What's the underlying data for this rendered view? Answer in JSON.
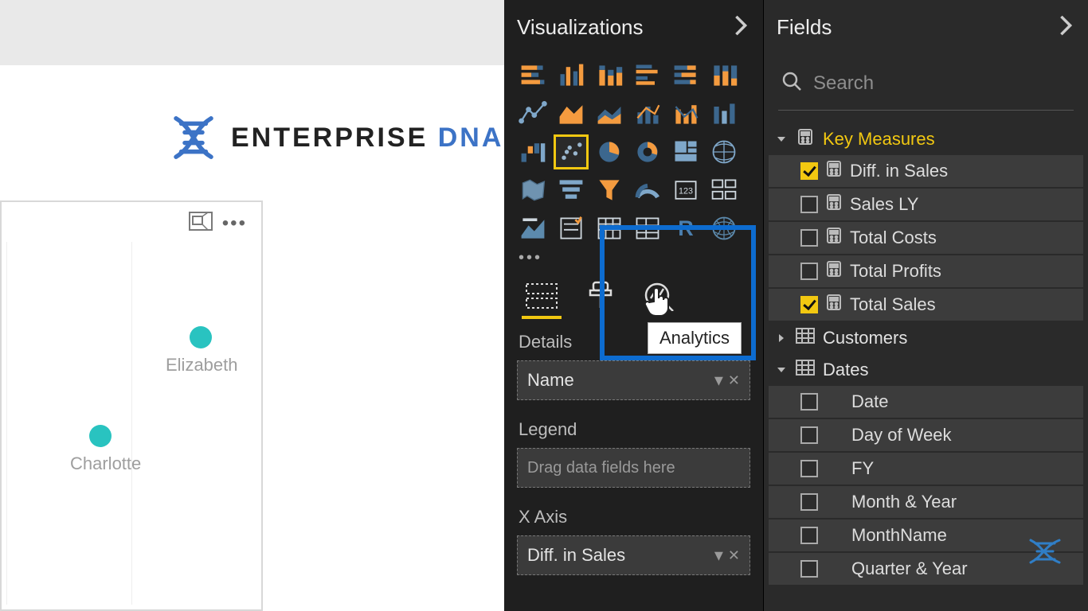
{
  "branding": {
    "name_a": "ENTERPRISE",
    "name_b": "DNA"
  },
  "canvas": {
    "scatter": {
      "points": [
        {
          "label": "Elizabeth"
        },
        {
          "label": "Charlotte"
        }
      ]
    }
  },
  "viz_pane": {
    "title": "Visualizations",
    "tooltip": "Analytics",
    "tabs": {
      "fields": "fields-tab",
      "format": "format-tab",
      "analytics": "analytics-tab"
    },
    "wells": {
      "details": {
        "label": "Details",
        "field": "Name"
      },
      "legend": {
        "label": "Legend",
        "placeholder": "Drag data fields here"
      },
      "xaxis": {
        "label": "X Axis",
        "field": "Diff. in Sales"
      }
    },
    "gallery": {
      "selected_index": 13,
      "icons": [
        "stacked-bar",
        "clustered-column",
        "stacked-column",
        "clustered-bar",
        "100-stacked-bar",
        "100-stacked-column",
        "line",
        "area",
        "stacked-area",
        "line-column",
        "line-column2",
        "ribbon",
        "waterfall",
        "scatter",
        "pie",
        "donut",
        "treemap",
        "map",
        "filled-map",
        "funnel-alt",
        "funnel",
        "gauge",
        "card",
        "multi-card",
        "kpi",
        "slicer",
        "table",
        "matrix",
        "r-visual",
        "arc-gis"
      ]
    }
  },
  "fields_pane": {
    "title": "Fields",
    "search_placeholder": "Search",
    "tables": [
      {
        "name": "Key Measures",
        "expanded": true,
        "highlighted": true,
        "icon": "measure-table",
        "fields": [
          {
            "name": "Diff. in Sales",
            "checked": true,
            "icon": "calc"
          },
          {
            "name": "Sales LY",
            "checked": false,
            "icon": "calc"
          },
          {
            "name": "Total Costs",
            "checked": false,
            "icon": "calc"
          },
          {
            "name": "Total Profits",
            "checked": false,
            "icon": "calc"
          },
          {
            "name": "Total Sales",
            "checked": true,
            "icon": "calc"
          }
        ]
      },
      {
        "name": "Customers",
        "expanded": false,
        "icon": "table",
        "fields": []
      },
      {
        "name": "Dates",
        "expanded": true,
        "icon": "table",
        "fields": [
          {
            "name": "Date",
            "checked": false
          },
          {
            "name": "Day of Week",
            "checked": false
          },
          {
            "name": "FY",
            "checked": false
          },
          {
            "name": "Month & Year",
            "checked": false
          },
          {
            "name": "MonthName",
            "checked": false
          },
          {
            "name": "Quarter & Year",
            "checked": false
          }
        ]
      }
    ]
  }
}
